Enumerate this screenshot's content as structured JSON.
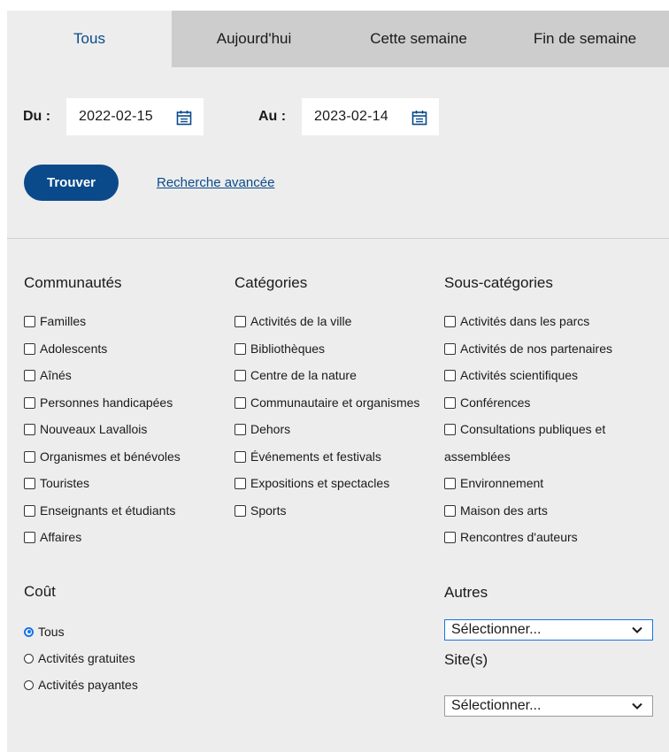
{
  "tabs": [
    {
      "label": "Tous"
    },
    {
      "label": "Aujourd'hui"
    },
    {
      "label": "Cette semaine"
    },
    {
      "label": "Fin de semaine"
    }
  ],
  "active_tab": "Tous",
  "dates": {
    "from_label": "Du :",
    "from_value": "2022-02-15",
    "to_label": "Au :",
    "to_value": "2023-02-14"
  },
  "actions": {
    "find_label": "Trouver",
    "advanced_label": "Recherche avancée"
  },
  "communities": {
    "title": "Communautés",
    "items": [
      "Familles",
      "Adolescents",
      "Aînés",
      "Personnes handicapées",
      "Nouveaux Lavallois",
      "Organismes et bénévoles",
      "Touristes",
      "Enseignants et étudiants",
      "Affaires"
    ]
  },
  "categories": {
    "title": "Catégories",
    "items": [
      "Activités de la ville",
      "Bibliothèques",
      "Centre de la nature",
      "Communautaire et organismes",
      "Dehors",
      "Événements et festivals",
      "Expositions et spectacles",
      "Sports"
    ]
  },
  "subcategories": {
    "title": "Sous-catégories",
    "items": [
      "Activités dans les parcs",
      "Activités de nos partenaires",
      "Activités scientifiques",
      "Conférences",
      "Consultations publiques et",
      "assemblées",
      "Environnement",
      "Maison des arts",
      "Rencontres d'auteurs"
    ]
  },
  "cost": {
    "title": "Coût",
    "options": [
      "Tous",
      "Activités gratuites",
      "Activités payantes"
    ],
    "selected": "Tous"
  },
  "others": {
    "title": "Autres",
    "selected": "Sélectionner..."
  },
  "sites": {
    "title": "Site(s)",
    "selected": "Sélectionner..."
  },
  "colors": {
    "accent": "#0a4a8a",
    "panel_bg": "#ededed",
    "inactive_tab_bg": "#cdcdcd",
    "radio_checked": "#1a73e8"
  }
}
